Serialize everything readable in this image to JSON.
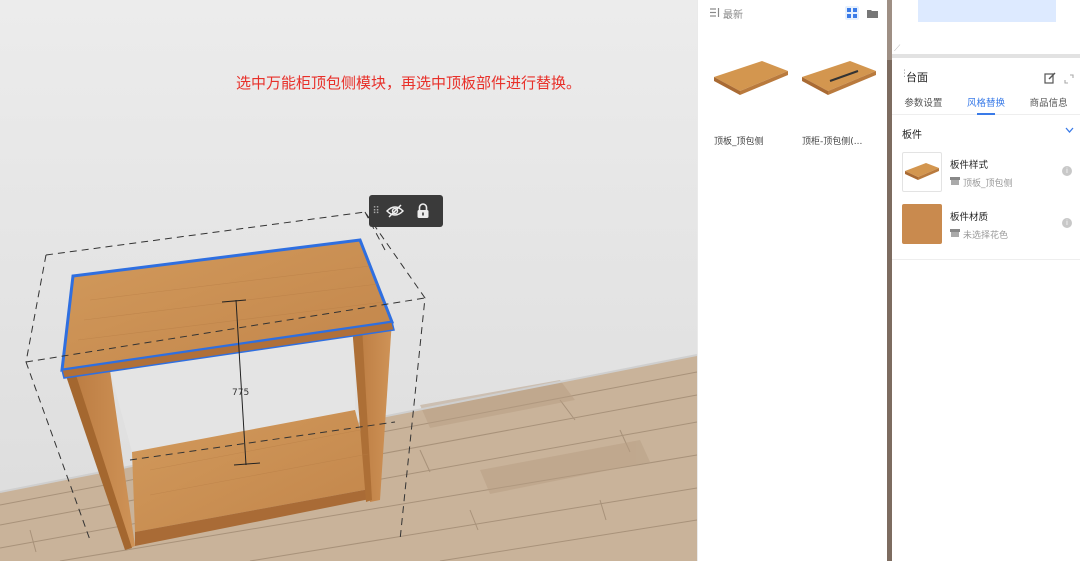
{
  "viewport": {
    "instruction": "选中万能柜顶包侧模块，再选中顶板部件进行替换。",
    "dimension_label": "775"
  },
  "toolbar": {
    "hide_icon": "eye-off-icon",
    "lock_icon": "lock-icon"
  },
  "library": {
    "header_label": "最新",
    "items": [
      {
        "name": "顶板_顶包侧"
      },
      {
        "name": "顶柜-顶包侧(..."
      }
    ]
  },
  "inspector": {
    "title": "台面",
    "tabs": [
      {
        "label": "参数设置",
        "active": false
      },
      {
        "label": "风格替换",
        "active": true
      },
      {
        "label": "商品信息",
        "active": false
      }
    ],
    "section_title": "板件",
    "props": [
      {
        "name": "板件样式",
        "value": "顶板_顶包侧"
      },
      {
        "name": "板件材质",
        "value": "未选择花色"
      }
    ]
  },
  "colors": {
    "accent": "#3a7be8",
    "instruction_red": "#e8302a",
    "wood": "#c98a4e",
    "selection_blue": "#2f6fe0"
  }
}
